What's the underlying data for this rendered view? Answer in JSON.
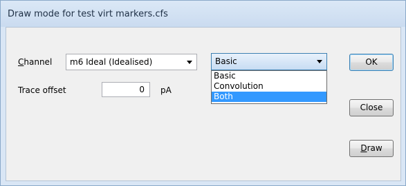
{
  "window": {
    "title": "Draw mode for test virt markers.cfs"
  },
  "channel": {
    "label_accel": "C",
    "label_rest": "hannel",
    "value": "m6 Ideal (Idealised)"
  },
  "trace_offset": {
    "label": "Trace offset",
    "value": "0",
    "unit": "pA"
  },
  "mode": {
    "selected": "Basic",
    "options": [
      "Basic",
      "Convolution",
      "Both"
    ],
    "highlighted": "Both"
  },
  "buttons": {
    "ok": "OK",
    "close": "Close",
    "draw_accel": "D",
    "draw_rest": "raw"
  }
}
